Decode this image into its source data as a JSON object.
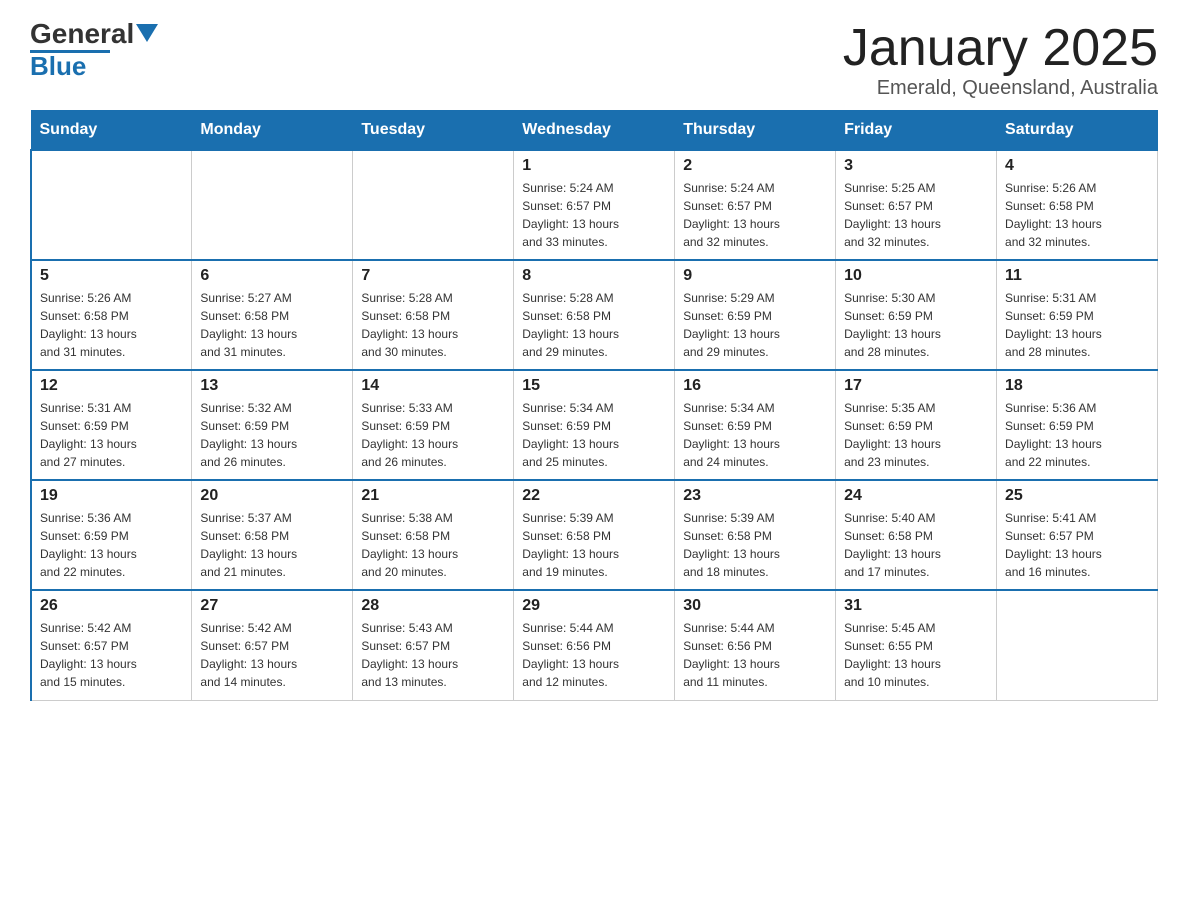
{
  "header": {
    "logo": {
      "text_general": "General",
      "text_blue": "Blue"
    },
    "title": "January 2025",
    "subtitle": "Emerald, Queensland, Australia"
  },
  "days_of_week": [
    "Sunday",
    "Monday",
    "Tuesday",
    "Wednesday",
    "Thursday",
    "Friday",
    "Saturday"
  ],
  "weeks": [
    [
      {
        "day": "",
        "info": ""
      },
      {
        "day": "",
        "info": ""
      },
      {
        "day": "",
        "info": ""
      },
      {
        "day": "1",
        "info": "Sunrise: 5:24 AM\nSunset: 6:57 PM\nDaylight: 13 hours\nand 33 minutes."
      },
      {
        "day": "2",
        "info": "Sunrise: 5:24 AM\nSunset: 6:57 PM\nDaylight: 13 hours\nand 32 minutes."
      },
      {
        "day": "3",
        "info": "Sunrise: 5:25 AM\nSunset: 6:57 PM\nDaylight: 13 hours\nand 32 minutes."
      },
      {
        "day": "4",
        "info": "Sunrise: 5:26 AM\nSunset: 6:58 PM\nDaylight: 13 hours\nand 32 minutes."
      }
    ],
    [
      {
        "day": "5",
        "info": "Sunrise: 5:26 AM\nSunset: 6:58 PM\nDaylight: 13 hours\nand 31 minutes."
      },
      {
        "day": "6",
        "info": "Sunrise: 5:27 AM\nSunset: 6:58 PM\nDaylight: 13 hours\nand 31 minutes."
      },
      {
        "day": "7",
        "info": "Sunrise: 5:28 AM\nSunset: 6:58 PM\nDaylight: 13 hours\nand 30 minutes."
      },
      {
        "day": "8",
        "info": "Sunrise: 5:28 AM\nSunset: 6:58 PM\nDaylight: 13 hours\nand 29 minutes."
      },
      {
        "day": "9",
        "info": "Sunrise: 5:29 AM\nSunset: 6:59 PM\nDaylight: 13 hours\nand 29 minutes."
      },
      {
        "day": "10",
        "info": "Sunrise: 5:30 AM\nSunset: 6:59 PM\nDaylight: 13 hours\nand 28 minutes."
      },
      {
        "day": "11",
        "info": "Sunrise: 5:31 AM\nSunset: 6:59 PM\nDaylight: 13 hours\nand 28 minutes."
      }
    ],
    [
      {
        "day": "12",
        "info": "Sunrise: 5:31 AM\nSunset: 6:59 PM\nDaylight: 13 hours\nand 27 minutes."
      },
      {
        "day": "13",
        "info": "Sunrise: 5:32 AM\nSunset: 6:59 PM\nDaylight: 13 hours\nand 26 minutes."
      },
      {
        "day": "14",
        "info": "Sunrise: 5:33 AM\nSunset: 6:59 PM\nDaylight: 13 hours\nand 26 minutes."
      },
      {
        "day": "15",
        "info": "Sunrise: 5:34 AM\nSunset: 6:59 PM\nDaylight: 13 hours\nand 25 minutes."
      },
      {
        "day": "16",
        "info": "Sunrise: 5:34 AM\nSunset: 6:59 PM\nDaylight: 13 hours\nand 24 minutes."
      },
      {
        "day": "17",
        "info": "Sunrise: 5:35 AM\nSunset: 6:59 PM\nDaylight: 13 hours\nand 23 minutes."
      },
      {
        "day": "18",
        "info": "Sunrise: 5:36 AM\nSunset: 6:59 PM\nDaylight: 13 hours\nand 22 minutes."
      }
    ],
    [
      {
        "day": "19",
        "info": "Sunrise: 5:36 AM\nSunset: 6:59 PM\nDaylight: 13 hours\nand 22 minutes."
      },
      {
        "day": "20",
        "info": "Sunrise: 5:37 AM\nSunset: 6:58 PM\nDaylight: 13 hours\nand 21 minutes."
      },
      {
        "day": "21",
        "info": "Sunrise: 5:38 AM\nSunset: 6:58 PM\nDaylight: 13 hours\nand 20 minutes."
      },
      {
        "day": "22",
        "info": "Sunrise: 5:39 AM\nSunset: 6:58 PM\nDaylight: 13 hours\nand 19 minutes."
      },
      {
        "day": "23",
        "info": "Sunrise: 5:39 AM\nSunset: 6:58 PM\nDaylight: 13 hours\nand 18 minutes."
      },
      {
        "day": "24",
        "info": "Sunrise: 5:40 AM\nSunset: 6:58 PM\nDaylight: 13 hours\nand 17 minutes."
      },
      {
        "day": "25",
        "info": "Sunrise: 5:41 AM\nSunset: 6:57 PM\nDaylight: 13 hours\nand 16 minutes."
      }
    ],
    [
      {
        "day": "26",
        "info": "Sunrise: 5:42 AM\nSunset: 6:57 PM\nDaylight: 13 hours\nand 15 minutes."
      },
      {
        "day": "27",
        "info": "Sunrise: 5:42 AM\nSunset: 6:57 PM\nDaylight: 13 hours\nand 14 minutes."
      },
      {
        "day": "28",
        "info": "Sunrise: 5:43 AM\nSunset: 6:57 PM\nDaylight: 13 hours\nand 13 minutes."
      },
      {
        "day": "29",
        "info": "Sunrise: 5:44 AM\nSunset: 6:56 PM\nDaylight: 13 hours\nand 12 minutes."
      },
      {
        "day": "30",
        "info": "Sunrise: 5:44 AM\nSunset: 6:56 PM\nDaylight: 13 hours\nand 11 minutes."
      },
      {
        "day": "31",
        "info": "Sunrise: 5:45 AM\nSunset: 6:55 PM\nDaylight: 13 hours\nand 10 minutes."
      },
      {
        "day": "",
        "info": ""
      }
    ]
  ]
}
